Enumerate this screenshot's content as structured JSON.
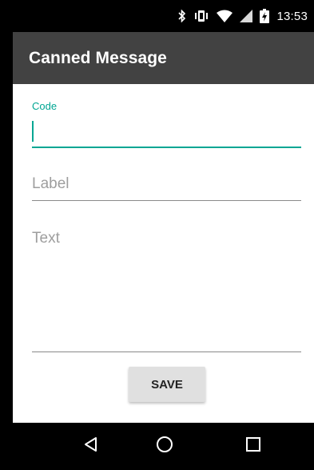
{
  "status_bar": {
    "time": "13:53",
    "icons": [
      "bluetooth-icon",
      "vibrate-icon",
      "wifi-icon",
      "signal-icon",
      "battery-charging-icon"
    ]
  },
  "app_bar": {
    "title": "Canned Message"
  },
  "form": {
    "code": {
      "label": "Code",
      "value": ""
    },
    "label_field": {
      "placeholder": "Label",
      "value": ""
    },
    "text_field": {
      "placeholder": "Text",
      "value": ""
    },
    "save_label": "SAVE"
  },
  "nav_bar": {
    "icons": [
      "back-icon",
      "home-icon",
      "recents-icon"
    ]
  },
  "colors": {
    "accent": "#00a693",
    "app_bar": "#424242",
    "button": "#e0e0e0"
  }
}
